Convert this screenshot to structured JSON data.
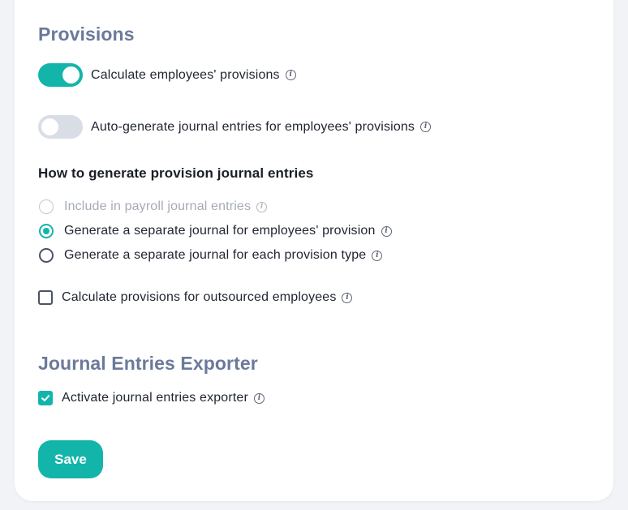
{
  "provisions": {
    "title": "Provisions",
    "calculate_toggle": {
      "label": "Calculate employees' provisions",
      "checked": true
    },
    "autogen_toggle": {
      "label": "Auto-generate journal entries for employees' provisions",
      "checked": false
    },
    "how_to_heading": "How to generate provision journal entries",
    "options": [
      {
        "label": "Include in payroll journal entries",
        "state": "disabled"
      },
      {
        "label": "Generate a separate journal for employees' provision",
        "state": "checked"
      },
      {
        "label": "Generate a separate journal for each provision type",
        "state": "unchecked"
      }
    ],
    "outsourced_checkbox": {
      "label": "Calculate provisions for outsourced employees",
      "checked": false
    }
  },
  "exporter": {
    "title": "Journal Entries Exporter",
    "activate_checkbox": {
      "label": "Activate journal entries exporter",
      "checked": true
    }
  },
  "actions": {
    "save_label": "Save"
  },
  "colors": {
    "accent": "#13b5ab",
    "section_title": "#6b7a9b",
    "toggle_off": "#d9dde6"
  },
  "icons": {
    "info": "info-circle-icon",
    "check": "check-icon"
  }
}
